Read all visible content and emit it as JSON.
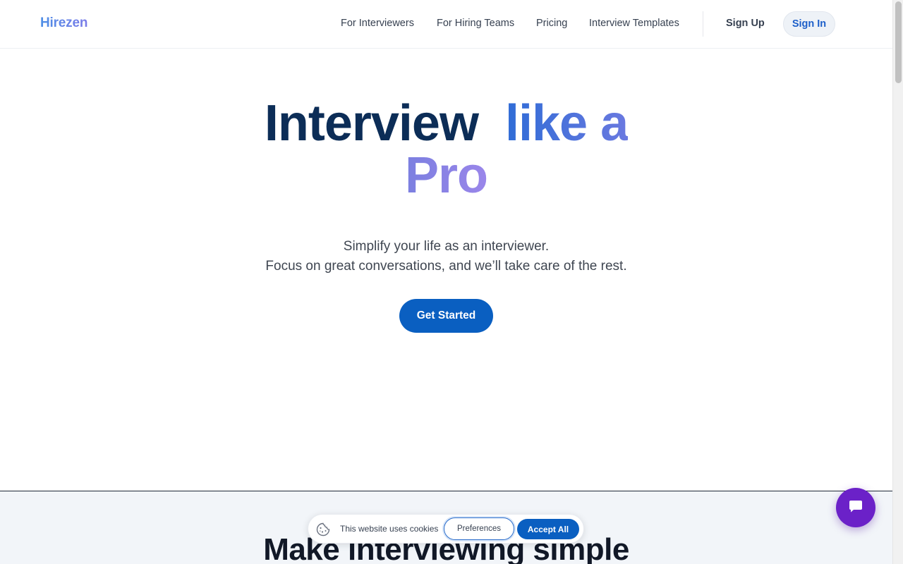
{
  "header": {
    "logo": "Hirezen",
    "nav": [
      {
        "label": "For Interviewers"
      },
      {
        "label": "For Hiring Teams"
      },
      {
        "label": "Pricing"
      },
      {
        "label": "Interview Templates"
      }
    ],
    "sign_up": "Sign Up",
    "sign_in": "Sign In"
  },
  "hero": {
    "title_part1": "Interview",
    "title_part2": "like a",
    "title_part3": "Pro",
    "subtitle_line1": "Simplify your life as an interviewer.",
    "subtitle_line2": "Focus on great conversations, and we’ll take care of the rest.",
    "cta": "Get Started"
  },
  "section2": {
    "title": "Make interviewing simple"
  },
  "cookie_banner": {
    "icon": "cookie-icon",
    "text": "This website uses cookies",
    "preferences": "Preferences",
    "accept_all": "Accept All"
  },
  "chat_widget": {
    "icon": "chat-icon"
  },
  "colors": {
    "primary": "#0a5fc1",
    "title_dark": "#0c2d57",
    "chat": "#6b21c8"
  }
}
